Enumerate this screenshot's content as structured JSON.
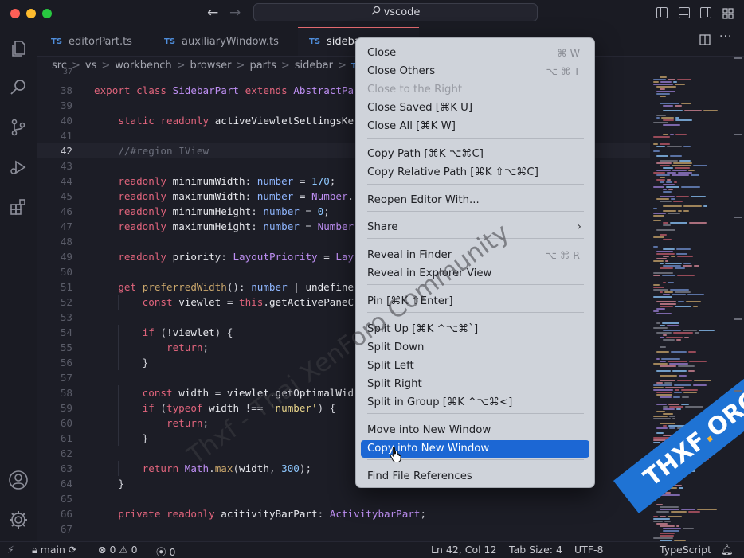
{
  "titlebar": {
    "search_text": "vscode",
    "back_arrow": "←",
    "forward_arrow": "→"
  },
  "tabs": [
    {
      "badge": "TS",
      "label": "editorPart.ts"
    },
    {
      "badge": "TS",
      "label": "auxiliaryWindow.ts"
    },
    {
      "badge": "TS",
      "label": "sideba"
    }
  ],
  "breadcrumb": [
    "src",
    "vs",
    "workbench",
    "browser",
    "parts",
    "sidebar",
    "side"
  ],
  "editor": {
    "top_partial_line": "37",
    "lines": [
      {
        "n": "38",
        "text": "export class SidebarPart extends AbstractPa"
      },
      {
        "n": "39",
        "text": ""
      },
      {
        "n": "40",
        "text": "    static readonly activeViewletSettingsKe"
      },
      {
        "n": "41",
        "text": ""
      },
      {
        "n": "42",
        "text": "    //#region IView"
      },
      {
        "n": "43",
        "text": ""
      },
      {
        "n": "44",
        "text": "    readonly minimumWidth: number = 170;"
      },
      {
        "n": "45",
        "text": "    readonly maximumWidth: number = Number."
      },
      {
        "n": "46",
        "text": "    readonly minimumHeight: number = 0;"
      },
      {
        "n": "47",
        "text": "    readonly maximumHeight: number = Number"
      },
      {
        "n": "48",
        "text": ""
      },
      {
        "n": "49",
        "text": "    readonly priority: LayoutPriority = Lay"
      },
      {
        "n": "50",
        "text": ""
      },
      {
        "n": "51",
        "text": "    get preferredWidth(): number | undefine"
      },
      {
        "n": "52",
        "text": "        const viewlet = this.getActivePaneC"
      },
      {
        "n": "53",
        "text": ""
      },
      {
        "n": "54",
        "text": "        if (!viewlet) {"
      },
      {
        "n": "55",
        "text": "            return;"
      },
      {
        "n": "56",
        "text": "        }"
      },
      {
        "n": "57",
        "text": ""
      },
      {
        "n": "58",
        "text": "        const width = viewlet.getOptimalWid"
      },
      {
        "n": "59",
        "text": "        if (typeof width !== 'number') {"
      },
      {
        "n": "60",
        "text": "            return;"
      },
      {
        "n": "61",
        "text": "        }"
      },
      {
        "n": "62",
        "text": ""
      },
      {
        "n": "63",
        "text": "        return Math.max(width, 300);"
      },
      {
        "n": "64",
        "text": "    }"
      },
      {
        "n": "65",
        "text": ""
      },
      {
        "n": "66",
        "text": "    private readonly acitivityBarPart: ActivitybarPart;"
      },
      {
        "n": "67",
        "text": ""
      }
    ]
  },
  "context_menu": {
    "items": [
      {
        "label": "Close",
        "shortcut": "⌘ W"
      },
      {
        "label": "Close Others",
        "shortcut": "⌥ ⌘ T"
      },
      {
        "label": "Close to the Right",
        "shortcut": "",
        "disabled": true
      },
      {
        "label": "Close Saved [⌘K U]",
        "shortcut": ""
      },
      {
        "label": "Close All [⌘K W]",
        "shortcut": ""
      },
      {
        "label": "Copy Path [⌘K ⌥⌘C]",
        "shortcut": ""
      },
      {
        "label": "Copy Relative Path [⌘K ⇧⌥⌘C]",
        "shortcut": ""
      },
      {
        "label": "Reopen Editor With...",
        "shortcut": ""
      },
      {
        "label": "Share",
        "shortcut": "",
        "submenu": "›"
      },
      {
        "label": "Reveal in Finder",
        "shortcut": "⌥ ⌘ R"
      },
      {
        "label": "Reveal in Explorer View",
        "shortcut": ""
      },
      {
        "label": "Pin [⌘K ⇧Enter]",
        "shortcut": ""
      },
      {
        "label": "Split Up [⌘K ^⌥⌘`]",
        "shortcut": ""
      },
      {
        "label": "Split Down",
        "shortcut": ""
      },
      {
        "label": "Split Left",
        "shortcut": ""
      },
      {
        "label": "Split Right",
        "shortcut": ""
      },
      {
        "label": "Split in Group [⌘K ^⌥⌘<]",
        "shortcut": ""
      },
      {
        "label": "Move into New Window",
        "shortcut": ""
      },
      {
        "label": "Copy into New Window",
        "shortcut": "",
        "highlighted": true
      },
      {
        "label": "Find File References",
        "shortcut": ""
      }
    ]
  },
  "statusbar": {
    "branch": "main",
    "errors": "0",
    "warnings": "0",
    "ports": "0",
    "position": "Ln 42, Col 12",
    "tab_size": "Tab Size: 4",
    "encoding": "UTF-8",
    "language": "TypeScript"
  },
  "watermark": {
    "text": "Thxf - Thai XenForo Community",
    "ribbon_main": "THXF",
    "ribbon_dot": ".",
    "ribbon_tld": "ORG"
  },
  "colors": {
    "accent_highlight": "#1c67d4",
    "active_tab_border": "#e46a6f",
    "ts_badge": "#4f8edc"
  },
  "icons": {
    "activity": [
      "files-icon",
      "search-icon",
      "source-control-icon",
      "run-debug-icon",
      "extensions-icon",
      "account-icon",
      "settings-gear-icon"
    ]
  }
}
